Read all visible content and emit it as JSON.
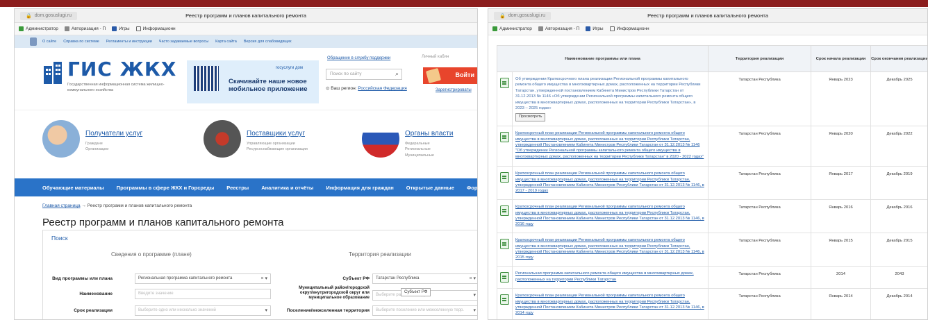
{
  "left": {
    "browser": {
      "url": "dom.gosuslugi.ru",
      "page_title": "Реестр программ и планов капитального ремонта",
      "bookmarks": [
        "Администратор",
        "Авторизация - П",
        "Игры",
        "Информационн"
      ]
    },
    "toplinks": [
      "О сайте",
      "Справка по системе",
      "Регламенты и инструкции",
      "Часто задаваемые вопросы",
      "Карта сайта",
      "Версия для слабовидящих"
    ],
    "header": {
      "logo": "ГИС ЖКХ",
      "logo_sub": "Государственная информационная система жилищно-коммунального хозяйства",
      "qr_top": "госуслуги дом",
      "qr_text": "Скачивайте наше новое мобильное приложение",
      "support_link": "Обращение в службу поддержки",
      "search_placeholder": "Поиск по сайту",
      "region_label": "Ваш регион:",
      "region_value": "Российская Федерация",
      "cabinet": "Личный кабин",
      "login": "Войти",
      "register": "Зарегистрироваты"
    },
    "categories": [
      {
        "title": "Получатели услуг",
        "subs": [
          "Граждане",
          "Организации"
        ]
      },
      {
        "title": "Поставщики услуг",
        "subs": [
          "Управляющие организации",
          "Ресурсоснабжающие организации"
        ]
      },
      {
        "title": "Органы власти",
        "subs": [
          "Федеральные",
          "Региональные",
          "Муниципальные"
        ]
      }
    ],
    "nav": [
      "Обучающие материалы",
      "Программы в сфере ЖКХ и Горсреды",
      "Реестры",
      "Аналитика и отчёты",
      "Информация для граждан",
      "Открытые данные",
      "Форум"
    ],
    "breadcrumb": {
      "home": "Главная страница",
      "separator": "→",
      "current": "Реестр программ и планов капитального ремонта"
    },
    "heading": "Реестр программ и планов капитального ремонта",
    "search": {
      "title": "Поиск",
      "section_program": "Сведения о программе (плане)",
      "section_territory": "Территория реализации",
      "fields": {
        "type_label": "Вид программы или плана",
        "type_value": "Региональная программа капитального ремонта",
        "name_label": "Наименование",
        "name_placeholder": "Введите значение",
        "period_label": "Срок реализации",
        "period_placeholder": "Выберите одно или несколько значений",
        "subject_label": "Субъект РФ",
        "subject_value": "Татарстан Республика",
        "municipal_label": "Муниципальный район/городской округ/внутригородской округ или муниципальное образование",
        "municipal_placeholder": "Выберите район или округ",
        "settlement_label": "Поселение/межселенная территория",
        "settlement_placeholder": "Выберите поселение или межселенную терр."
      },
      "tooltip": "Субъект РФ"
    }
  },
  "right": {
    "browser": {
      "url": "dom.gosuslugi.ru",
      "page_title": "Реестр программ и планов капитального ремонта",
      "bookmarks": [
        "Администратор",
        "Авторизация - П",
        "Игры",
        "Информационн"
      ]
    },
    "table": {
      "headers": [
        "Наименование программы или плана",
        "Территория реализации",
        "Срок начала реализации",
        "Срок окончания реализации"
      ],
      "view_button": "Просмотреть",
      "rows": [
        {
          "name": "Об утверждении Краткосрочного плана реализации Региональной программы капитального ремонта общего имущества в многоквартирных домах, расположенных на территории Республики Татарстан, утвержденной постановлением Кабинета Министров Республики Татарстан от 31.12.2013 № 1146 «Об утверждении Региональной программы капитального ремонта общего имущества в многоквартирных домах, расположенных на территории Республики Татарстан», в 2023 – 2025 годах»",
          "territory": "Татарстан Республика",
          "start": "Январь 2023",
          "end": "Декабрь 2025"
        },
        {
          "name": "Краткосрочный план реализации Региональной программы капитального ремонта общего имущества в многоквартирных домах, расположенных на территории Республики Татарстан, утвержденной Постановлением Кабинета Министров Республики Татарстан от 31.12.2013 № 1146 \"Об утверждении Региональной программы капитального ремонта общего имущества в многоквартирных домах, расположенных на территории Республики Татарстан\" в 2020 - 2022 годах\"",
          "territory": "Татарстан Республика",
          "start": "Январь 2020",
          "end": "Декабрь 2022"
        },
        {
          "name": "Краткосрочный план реализации Региональной программы капитального ремонта общего имущества в многоквартирных домах, расположенных на территории Республики Татарстан, утвержденной Постановлением Кабинета Министров Республики Татарстан от 31.12.2013 № 1146, в 2017 - 2019 годах",
          "territory": "Татарстан Республика",
          "start": "Январь 2017",
          "end": "Декабрь 2019"
        },
        {
          "name": "Краткосрочный план реализации Региональной программы капитального ремонта общего имущества в многоквартирных домах, расположенных на территории Республики Татарстан, утвержденной Постановлением Кабинета Министров Республики Татарстан от 31.12.2013 № 1146, в 2016 году",
          "territory": "Татарстан Республика",
          "start": "Январь 2016",
          "end": "Декабрь 2016"
        },
        {
          "name": "Краткосрочный план реализации Региональной программы капитального ремонта общего имущества в многоквартирных домах, расположенных на территории Республики Татарстан, утвержденной Постановлением Кабинета Министров Республики Татарстан от 31.12.2013 № 1146, в 2015 году",
          "territory": "Татарстан Республика",
          "start": "Январь 2015",
          "end": "Декабрь 2015"
        },
        {
          "name": "Региональная программа капитального ремонта общего имущества в многоквартирных домах, расположенных на территории Республики Татарстан",
          "territory": "Татарстан Республика",
          "start": "2014",
          "end": "2043"
        },
        {
          "name": "Краткосрочный план реализации Региональной программы капитального ремонта общего имущества в многоквартирных домах, расположенных на территории Республики Татарстан, утвержденной Постановлением Кабинета Министров Республики Татарстан от 31.12.2013 № 1146, в 2014 году",
          "territory": "Татарстан Республика",
          "start": "Январь 2014",
          "end": "Декабрь 2014"
        }
      ]
    }
  }
}
